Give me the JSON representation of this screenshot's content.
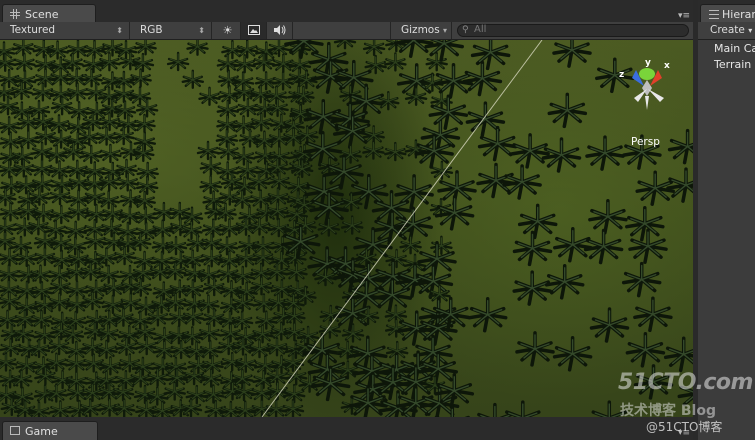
{
  "scene_tab": {
    "title": "Scene",
    "icon": "grid-icon"
  },
  "scene_toolbar": {
    "draw_mode": "Textured",
    "render_mode": "RGB",
    "lighting_icon": "sun-icon",
    "image_icon": "image-icon",
    "audio_icon": "speaker-icon",
    "gizmos_label": "Gizmos",
    "search_placeholder": "All"
  },
  "viewport": {
    "projection_label": "Persp",
    "gizmo_axes": {
      "x": "x",
      "y": "y",
      "z": "z"
    },
    "colors": {
      "x_axis": "#e0402a",
      "y_axis": "#7ad43a",
      "z_axis": "#3a6de0"
    }
  },
  "hierarchy": {
    "title": "Hierarchy",
    "create_label": "Create",
    "items": [
      "Main Camera",
      "Terrain"
    ]
  },
  "game_tab": {
    "title": "Game"
  },
  "watermark": {
    "logo": "51CTO.com",
    "tagline": "技术博客 Blog",
    "credit": "@51CTO博客"
  }
}
